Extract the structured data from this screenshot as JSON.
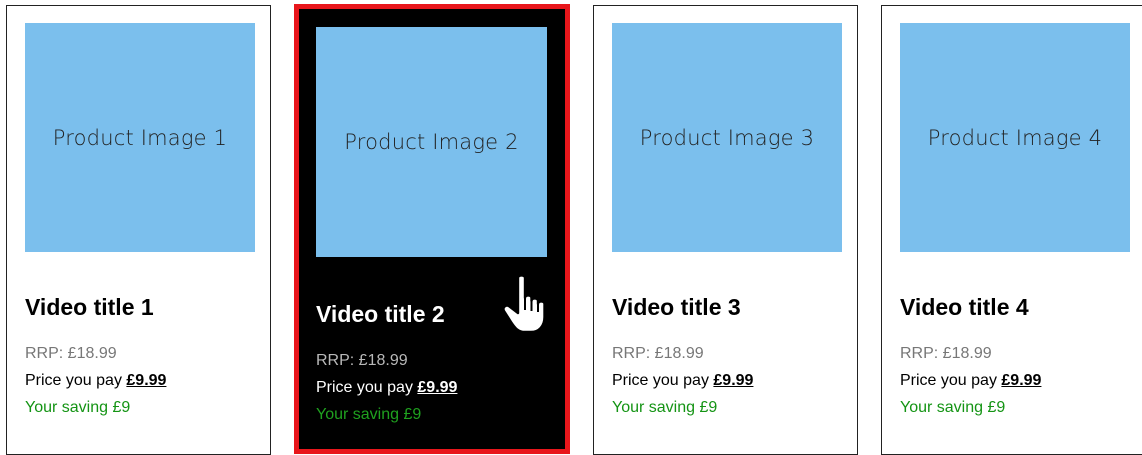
{
  "products": [
    {
      "image_label": "Product Image 1",
      "title": "Video title 1",
      "rrp": "RRP: £18.99",
      "pay_label": "Price you pay ",
      "price": "£9.99",
      "saving": "Your saving £9",
      "hovered": false
    },
    {
      "image_label": "Product Image 2",
      "title": "Video title 2",
      "rrp": "RRP: £18.99",
      "pay_label": "Price you pay ",
      "price": "£9.99",
      "saving": "Your saving £9",
      "hovered": true
    },
    {
      "image_label": "Product Image 3",
      "title": "Video title 3",
      "rrp": "RRP: £18.99",
      "pay_label": "Price you pay ",
      "price": "£9.99",
      "saving": "Your saving £9",
      "hovered": false
    },
    {
      "image_label": "Product Image 4",
      "title": "Video title 4",
      "rrp": "RRP: £18.99",
      "pay_label": "Price you pay ",
      "price": "£9.99",
      "saving": "Your saving £9",
      "hovered": false
    }
  ],
  "colors": {
    "image_placeholder": "#7bbfed",
    "hover_border": "#e8161b",
    "hover_background": "#000000",
    "saving_text": "#149414",
    "rrp_text": "#777777"
  },
  "cursor_icon": "hand-pointer-icon"
}
